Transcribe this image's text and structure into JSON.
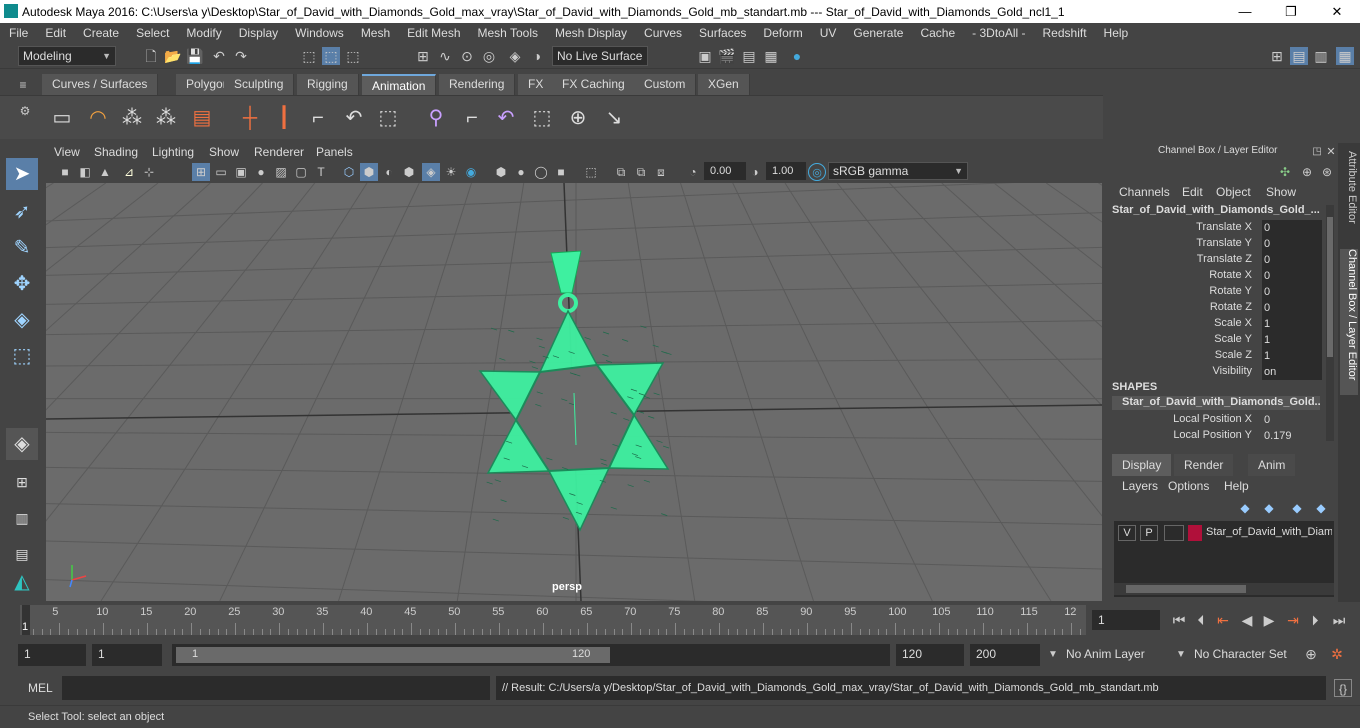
{
  "window": {
    "title": "Autodesk Maya 2016: C:\\Users\\a y\\Desktop\\Star_of_David_with_Diamonds_Gold_max_vray\\Star_of_David_with_Diamonds_Gold_mb_standart.mb   ---   Star_of_David_with_Diamonds_Gold_ncl1_1"
  },
  "menubar": [
    "File",
    "Edit",
    "Create",
    "Select",
    "Modify",
    "Display",
    "Windows",
    "Mesh",
    "Edit Mesh",
    "Mesh Tools",
    "Mesh Display",
    "Curves",
    "Surfaces",
    "Deform",
    "UV",
    "Generate",
    "Cache",
    "- 3DtoAll -",
    "Redshift",
    "Help"
  ],
  "statusline": {
    "mode": "Modeling",
    "live_surface": "No Live Surface"
  },
  "shelf_tabs": [
    "Curves / Surfaces",
    "Polygons",
    "Sculpting",
    "Rigging",
    "Animation",
    "Rendering",
    "FX",
    "FX Caching",
    "Custom",
    "XGen"
  ],
  "active_shelf_tab": "Animation",
  "panel_menu": [
    "View",
    "Shading",
    "Lighting",
    "Show",
    "Renderer",
    "Panels"
  ],
  "panel_toolbar": {
    "exposure": "0.00",
    "gamma": "1.00",
    "colorspace": "sRGB gamma"
  },
  "viewport": {
    "camera": "persp",
    "colors": {
      "mesh": "#3ef0a0"
    }
  },
  "channel_box": {
    "header": "Channel Box / Layer Editor",
    "menu": [
      "Channels",
      "Edit",
      "Object",
      "Show"
    ],
    "object": "Star_of_David_with_Diamonds_Gold_...",
    "attributes": [
      {
        "name": "Translate X",
        "value": "0"
      },
      {
        "name": "Translate Y",
        "value": "0"
      },
      {
        "name": "Translate Z",
        "value": "0"
      },
      {
        "name": "Rotate X",
        "value": "0"
      },
      {
        "name": "Rotate Y",
        "value": "0"
      },
      {
        "name": "Rotate Z",
        "value": "0"
      },
      {
        "name": "Scale X",
        "value": "1"
      },
      {
        "name": "Scale Y",
        "value": "1"
      },
      {
        "name": "Scale Z",
        "value": "1"
      },
      {
        "name": "Visibility",
        "value": "on"
      }
    ],
    "shapes_label": "SHAPES",
    "shape_name": "Star_of_David_with_Diamonds_Gold...",
    "shape_attributes": [
      {
        "name": "Local Position X",
        "value": "0"
      },
      {
        "name": "Local Position Y",
        "value": "0.179"
      }
    ]
  },
  "layer_editor": {
    "tabs": [
      "Display",
      "Render",
      "Anim"
    ],
    "menu": [
      "Layers",
      "Options",
      "Help"
    ],
    "layer": {
      "v": "V",
      "p": "P",
      "name": "Star_of_David_with_Diam",
      "color": "#b0103a"
    }
  },
  "side_tabs": [
    "Attribute Editor",
    "Channel Box / Layer Editor"
  ],
  "timeline": {
    "ticks": [
      "5",
      "10",
      "15",
      "20",
      "25",
      "30",
      "35",
      "40",
      "45",
      "50",
      "55",
      "60",
      "65",
      "70",
      "75",
      "80",
      "85",
      "90",
      "95",
      "100",
      "105",
      "110",
      "115",
      "12"
    ],
    "start_marker": "1",
    "current_frame": "1"
  },
  "range": {
    "start": "1",
    "anim_start": "1",
    "slider_start": "1",
    "slider_end": "120",
    "end": "120",
    "anim_end": "200",
    "anim_layer": "No Anim Layer",
    "char_set": "No Character Set"
  },
  "command": {
    "lang": "MEL",
    "result": "// Result: C:/Users/a y/Desktop/Star_of_David_with_Diamonds_Gold_max_vray/Star_of_David_with_Diamonds_Gold_mb_standart.mb"
  },
  "help_line": "Select Tool: select an object"
}
